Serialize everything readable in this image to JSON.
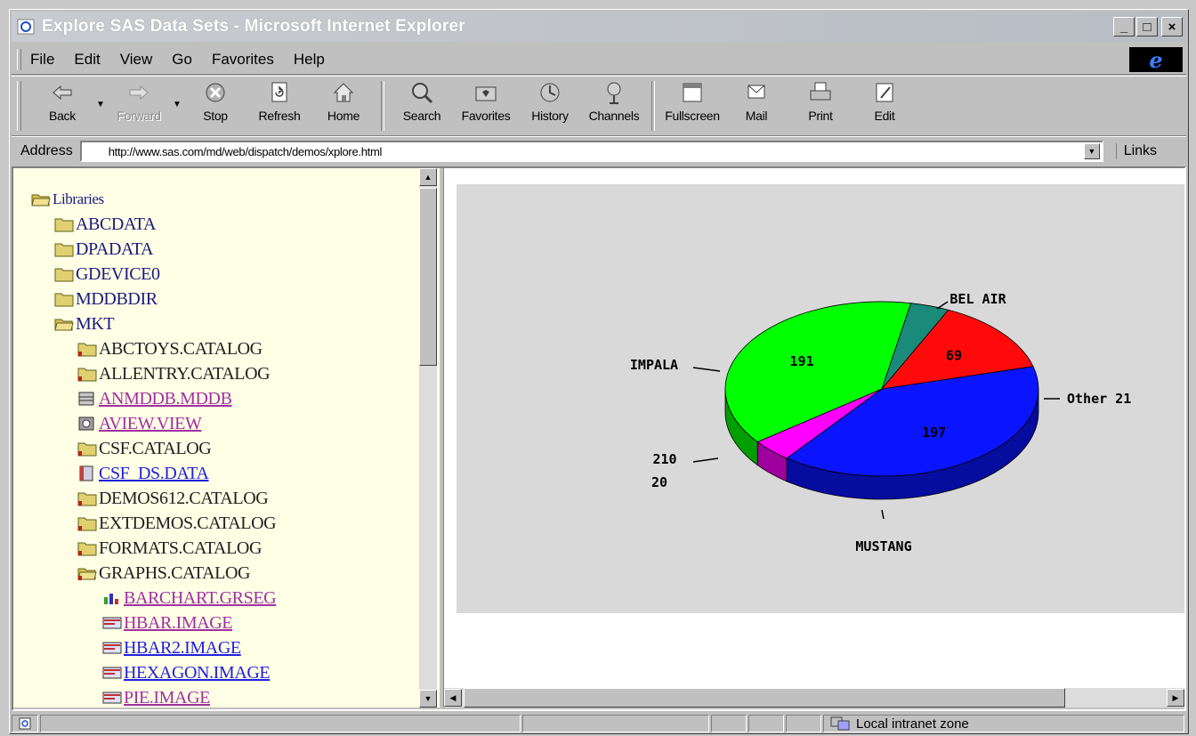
{
  "window": {
    "title": "Explore SAS Data Sets - Microsoft Internet Explorer",
    "minimize": "_",
    "maximize": "□",
    "close": "×"
  },
  "menu": [
    "File",
    "Edit",
    "View",
    "Go",
    "Favorites",
    "Help"
  ],
  "toolbar": {
    "buttons": [
      {
        "label": "Back",
        "icon": "back-arrow-icon"
      },
      {
        "label": "Forward",
        "icon": "forward-arrow-icon",
        "disabled": true
      },
      {
        "label": "Stop",
        "icon": "stop-icon"
      },
      {
        "label": "Refresh",
        "icon": "refresh-icon"
      },
      {
        "label": "Home",
        "icon": "home-icon"
      },
      {
        "label": "Search",
        "icon": "search-icon"
      },
      {
        "label": "Favorites",
        "icon": "favorites-icon"
      },
      {
        "label": "History",
        "icon": "history-icon"
      },
      {
        "label": "Channels",
        "icon": "channels-icon"
      },
      {
        "label": "Fullscreen",
        "icon": "fullscreen-icon"
      },
      {
        "label": "Mail",
        "icon": "mail-icon"
      },
      {
        "label": "Print",
        "icon": "print-icon"
      },
      {
        "label": "Edit",
        "icon": "edit-icon"
      }
    ]
  },
  "address": {
    "label": "Address",
    "url": "http://www.sas.com/md/web/dispatch/demos/xplore.html",
    "links": "Links"
  },
  "tree": {
    "root": "Libraries",
    "libraries": [
      "ABCDATA",
      "DPADATA",
      "GDEVICE0",
      "MDDBDIR"
    ],
    "open_library": "MKT",
    "members": [
      {
        "label": "ABCTOYS.CATALOG",
        "style": "dark",
        "icon": "catalog-folder-icon"
      },
      {
        "label": "ALLENTRY.CATALOG",
        "style": "dark",
        "icon": "catalog-folder-icon"
      },
      {
        "label": "ANMDDB.MDDB",
        "style": "link",
        "icon": "mddb-icon"
      },
      {
        "label": "AVIEW.VIEW",
        "style": "link",
        "icon": "view-icon"
      },
      {
        "label": "CSF.CATALOG",
        "style": "dark",
        "icon": "catalog-folder-icon"
      },
      {
        "label": "CSF_DS.DATA",
        "style": "blue",
        "icon": "data-set-icon"
      },
      {
        "label": "DEMOS612.CATALOG",
        "style": "dark",
        "icon": "catalog-folder-icon"
      },
      {
        "label": "EXTDEMOS.CATALOG",
        "style": "dark",
        "icon": "catalog-folder-icon"
      },
      {
        "label": "FORMATS.CATALOG",
        "style": "dark",
        "icon": "catalog-folder-icon"
      },
      {
        "label": "GRAPHS.CATALOG",
        "style": "dark",
        "icon": "open-catalog-folder-icon"
      }
    ],
    "entries": [
      {
        "label": "BARCHART.GRSEG",
        "style": "link",
        "icon": "grseg-icon"
      },
      {
        "label": "HBAR.IMAGE",
        "style": "link",
        "icon": "image-icon"
      },
      {
        "label": "HBAR2.IMAGE",
        "style": "blue",
        "icon": "image-icon"
      },
      {
        "label": "HEXAGON.IMAGE",
        "style": "blue",
        "icon": "image-icon"
      },
      {
        "label": "PIE.IMAGE",
        "style": "link",
        "icon": "image-icon"
      }
    ]
  },
  "chart_data": {
    "type": "pie",
    "title": "",
    "style": "3d",
    "slices": [
      {
        "label": "BEL AIR",
        "value": 197,
        "color": "#0a14ff",
        "show_value_inside": true
      },
      {
        "label": "Other",
        "value": 21,
        "color": "#ff00ff",
        "show_value_inside": false
      },
      {
        "label": "MUSTANG",
        "value": 191,
        "color": "#00ff00",
        "show_value_inside": true
      },
      {
        "label": "210",
        "value": 20,
        "color": "#1a8a7a",
        "show_value_inside": false
      },
      {
        "label": "IMPALA",
        "value": 69,
        "color": "#ff0a0a",
        "show_value_inside": true
      }
    ],
    "outside_labels": {
      "BEL AIR": "BEL AIR",
      "Other": "Other 21",
      "MUSTANG": "MUSTANG",
      "210": "210",
      "210_value": "20",
      "IMPALA": "IMPALA"
    },
    "background": "#d9d9d9"
  },
  "status": {
    "zone": "Local intranet zone"
  }
}
